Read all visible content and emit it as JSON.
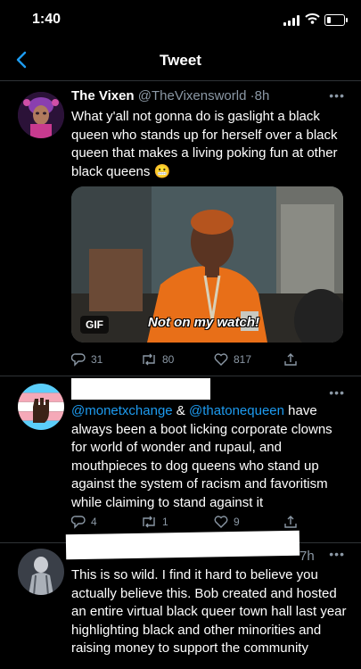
{
  "status_bar": {
    "time": "1:40"
  },
  "nav": {
    "title": "Tweet"
  },
  "main_tweet": {
    "display_name": "The Vixen",
    "handle": "@TheVixensworld",
    "separator": "·",
    "time": "8h",
    "text": "What y'all not gonna do is gaslight a black queen who stands up for herself over a black queen that makes a living poking fun at other black queens",
    "emoji": "😬",
    "gif_label": "GIF",
    "gif_caption": "Not on my watch!",
    "reply_count": "31",
    "retweet_count": "80",
    "like_count": "817"
  },
  "reply_1": {
    "mention_1": "@monetxchange",
    "connector": " & ",
    "mention_2": "@thatonequeen",
    "text": " have always been a boot licking corporate clowns for world of wonder and rupaul, and mouthpieces to dog queens who stand up against the system of racism and favoritism while claiming to stand against it",
    "reply_count": "4",
    "retweet_count": "1",
    "like_count": "9"
  },
  "reply_2": {
    "time": "7h",
    "text": "This is so wild. I find it hard to believe you actually believe this. Bob created and hosted an entire virtual black queer town hall last year highlighting black and other minorities and raising money to support the community"
  },
  "colors": {
    "accent": "#1d9bf0",
    "muted": "#8b98a5",
    "background": "#000000",
    "divider": "#2f3336"
  }
}
